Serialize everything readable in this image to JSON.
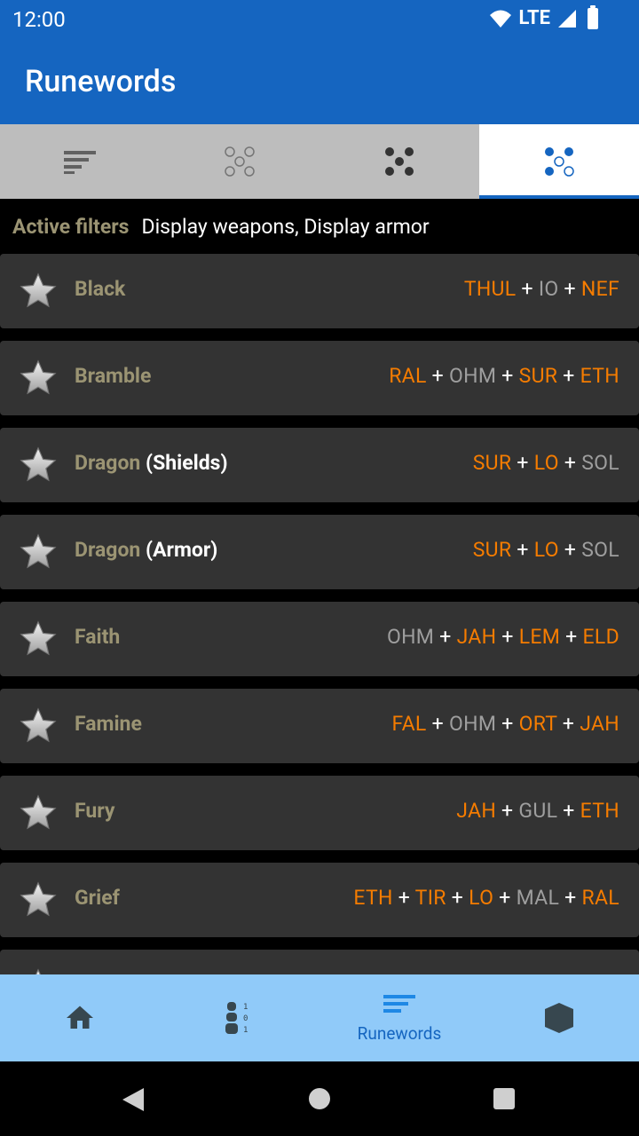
{
  "status": {
    "time": "12:00",
    "network": "LTE"
  },
  "app": {
    "title": "Runewords"
  },
  "tabs": [
    {
      "icon": "sort-lines-icon"
    },
    {
      "icon": "four-circles-outline-icon"
    },
    {
      "icon": "four-dots-filled-icon"
    },
    {
      "icon": "four-dots-mixed-icon",
      "selected": true
    }
  ],
  "filters": {
    "label": "Active filters",
    "value": "Display weapons, Display armor"
  },
  "runewords": [
    {
      "name": "Black",
      "sub": "",
      "runes": [
        [
          "THUL",
          "o"
        ],
        [
          "IO",
          "g"
        ],
        [
          "NEF",
          "o"
        ]
      ]
    },
    {
      "name": "Bramble",
      "sub": "",
      "runes": [
        [
          "RAL",
          "o"
        ],
        [
          "OHM",
          "g"
        ],
        [
          "SUR",
          "o"
        ],
        [
          "ETH",
          "o"
        ]
      ]
    },
    {
      "name": "Dragon",
      "sub": "(Shields)",
      "runes": [
        [
          "SUR",
          "o"
        ],
        [
          "LO",
          "o"
        ],
        [
          "SOL",
          "g"
        ]
      ]
    },
    {
      "name": "Dragon",
      "sub": "(Armor)",
      "runes": [
        [
          "SUR",
          "o"
        ],
        [
          "LO",
          "o"
        ],
        [
          "SOL",
          "g"
        ]
      ]
    },
    {
      "name": "Faith",
      "sub": "",
      "runes": [
        [
          "OHM",
          "g"
        ],
        [
          "JAH",
          "o"
        ],
        [
          "LEM",
          "o"
        ],
        [
          "ELD",
          "o"
        ]
      ]
    },
    {
      "name": "Famine",
      "sub": "",
      "runes": [
        [
          "FAL",
          "o"
        ],
        [
          "OHM",
          "g"
        ],
        [
          "ORT",
          "o"
        ],
        [
          "JAH",
          "o"
        ]
      ]
    },
    {
      "name": "Fury",
      "sub": "",
      "runes": [
        [
          "JAH",
          "o"
        ],
        [
          "GUL",
          "g"
        ],
        [
          "ETH",
          "o"
        ]
      ]
    },
    {
      "name": "Grief",
      "sub": "",
      "runes": [
        [
          "ETH",
          "o"
        ],
        [
          "TIR",
          "o"
        ],
        [
          "LO",
          "o"
        ],
        [
          "MAL",
          "g"
        ],
        [
          "RAL",
          "o"
        ]
      ]
    }
  ],
  "bottom_nav": [
    {
      "icon": "home-icon",
      "label": ""
    },
    {
      "icon": "runes-binary-icon",
      "label": ""
    },
    {
      "icon": "runewords-icon",
      "label": "Runewords",
      "active": true
    },
    {
      "icon": "hexagon-icon",
      "label": ""
    }
  ],
  "colors": {
    "primary": "#1565c0",
    "orange": "#f57c00",
    "gray": "#9e9e9e",
    "name": "#9b9473"
  }
}
